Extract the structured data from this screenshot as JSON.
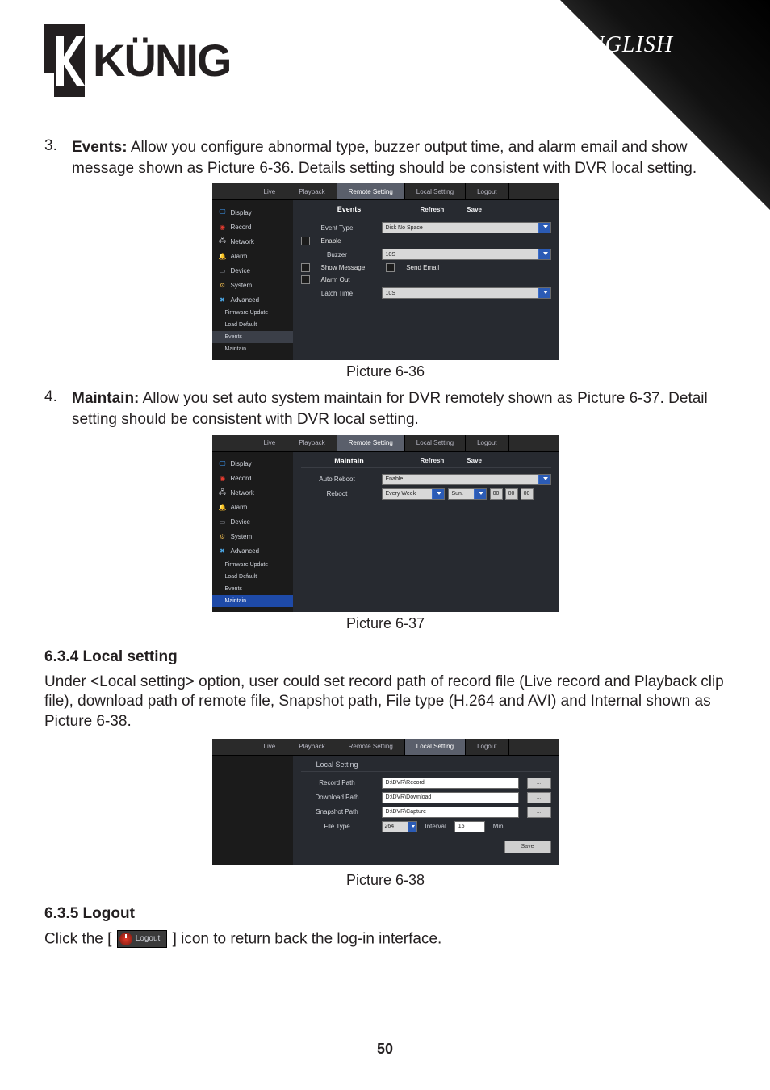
{
  "header": {
    "language": "ENGLISH",
    "logo_text": "KÜNIG"
  },
  "body": {
    "item3_number": "3.",
    "item3_label": "Events:",
    "item3_text": " Allow you configure abnormal type, buzzer output time, and alarm email and show message shown as Picture 6-36. Details setting should be consistent with DVR local setting.",
    "caption_636": "Picture 6-36",
    "item4_number": "4.",
    "item4_label": "Maintain:",
    "item4_text": " Allow you set auto system maintain for DVR remotely shown as Picture 6-37. Detail setting should be consistent with DVR local setting.",
    "caption_637": "Picture 6-37",
    "sec_634_heading": "6.3.4 Local setting",
    "sec_634_para": "Under <Local setting> option, user could set record path of record file (Live record and Playback clip file), download path of remote file, Snapshot path, File type (H.264 and AVI) and Internal shown as Picture 6-38.",
    "caption_638": "Picture 6-38",
    "sec_635_heading": "6.3.5 Logout",
    "sec_635_pre": "Click the [",
    "sec_635_post": "] icon to return back the log-in interface."
  },
  "inline_logout_icon": {
    "label": "Logout"
  },
  "page_number": "50",
  "tabs": {
    "live": "Live",
    "playback": "Playback",
    "remote": "Remote Setting",
    "local": "Local Setting",
    "logout": "Logout"
  },
  "sidebar": {
    "display": "Display",
    "record": "Record",
    "network": "Network",
    "alarm": "Alarm",
    "device": "Device",
    "system": "System",
    "advanced": "Advanced",
    "fw_update": "Firmware Update",
    "load_default": "Load Default",
    "events": "Events",
    "maintain": "Maintain"
  },
  "shot636": {
    "title": "Events",
    "refresh": "Refresh",
    "save": "Save",
    "event_type_lbl": "Event Type",
    "event_type_val": "Disk No Space",
    "enable_lbl": "Enable",
    "buzzer_lbl": "Buzzer",
    "buzzer_val": "10S",
    "show_msg": "Show Message",
    "send_email": "Send Email",
    "alarm_out": "Alarm Out",
    "latch_time_lbl": "Latch Time",
    "latch_time_val": "10S"
  },
  "shot637": {
    "title": "Maintain",
    "refresh": "Refresh",
    "save": "Save",
    "auto_reboot_lbl": "Auto Reboot",
    "auto_reboot_val": "Enable",
    "reboot_lbl": "Reboot",
    "schedule_prefix": "Every Week",
    "schedule_day": "Sun.",
    "schedule_h": "00",
    "schedule_m": "00",
    "schedule_s": "00"
  },
  "shot638": {
    "panel_title": "Local Setting",
    "record_path_lbl": "Record Path",
    "record_path_val": "D:\\DVR\\Record",
    "download_path_lbl": "Download Path",
    "download_path_val": "D:\\DVR\\Download",
    "snapshot_path_lbl": "Snapshot Path",
    "snapshot_path_val": "D:\\DVR\\Capture",
    "file_type_lbl": "File Type",
    "file_type_val": "264",
    "interval_lbl": "Interval",
    "interval_val": "15",
    "interval_unit": "Min",
    "browse": "...",
    "save": "Save"
  }
}
